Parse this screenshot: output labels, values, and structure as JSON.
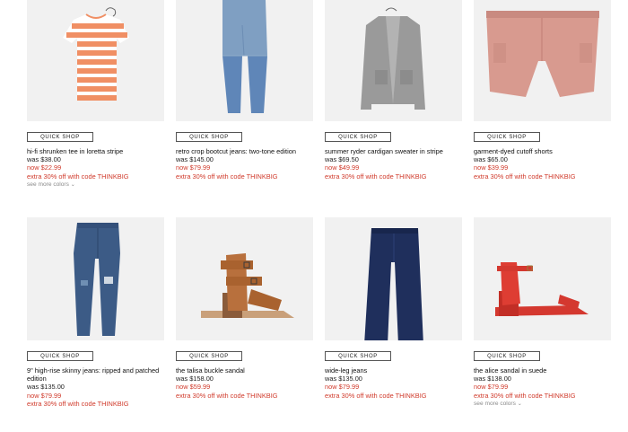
{
  "quick_shop_label": "QUICK SHOP",
  "colors": {
    "sale": "#d03a2b",
    "tile_bg": "#f1f1f1"
  },
  "products": [
    {
      "name": "hi-fi shrunken tee in loretta stripe",
      "was": "was $38.00",
      "now": "now $22.99",
      "promo": "extra 30% off with code THINKBIG",
      "more_colors": "see more colors",
      "image": "striped-tee"
    },
    {
      "name": "retro crop bootcut jeans: two-tone edition",
      "was": "was $145.00",
      "now": "now $79.99",
      "promo": "extra 30% off with code THINKBIG",
      "image": "two-tone-jeans"
    },
    {
      "name": "summer ryder cardigan sweater in stripe",
      "was": "was $69.50",
      "now": "now $49.99",
      "promo": "extra 30% off with code THINKBIG",
      "image": "gray-cardigan"
    },
    {
      "name": "garment-dyed cutoff shorts",
      "was": "was $65.00",
      "now": "now $39.99",
      "promo": "extra 30% off with code THINKBIG",
      "image": "pink-shorts"
    },
    {
      "name": "9\" high-rise skinny jeans: ripped and patched edition",
      "was": "was $135.00",
      "now": "now $79.99",
      "promo": "extra 30% off with code THINKBIG",
      "image": "skinny-jeans"
    },
    {
      "name": "the talisa buckle sandal",
      "was": "was $158.00",
      "now": "now $59.99",
      "promo": "extra 30% off with code THINKBIG",
      "image": "tan-buckle-sandal"
    },
    {
      "name": "wide-leg jeans",
      "was": "was $135.00",
      "now": "now $79.99",
      "promo": "extra 30% off with code THINKBIG",
      "image": "wide-leg-jeans"
    },
    {
      "name": "the alice sandal in suede",
      "was": "was $138.00",
      "now": "now $79.99",
      "promo": "extra 30% off with code THINKBIG",
      "more_colors": "see more colors",
      "image": "red-sandal"
    }
  ]
}
